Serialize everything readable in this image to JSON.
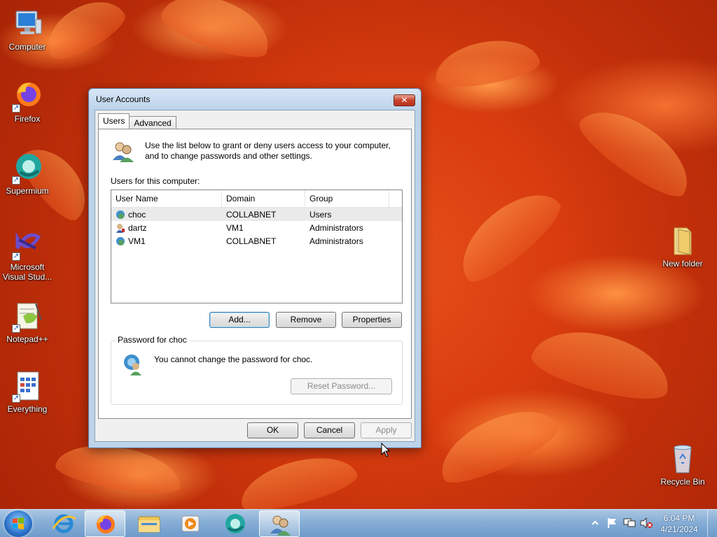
{
  "desktop": {
    "icons": [
      {
        "label": "Computer",
        "name": "computer-icon"
      },
      {
        "label": "Firefox",
        "name": "firefox-icon"
      },
      {
        "label": "Supermium",
        "name": "supermium-icon"
      },
      {
        "label": "Microsoft Visual Stud...",
        "name": "visual-studio-icon"
      },
      {
        "label": "Notepad++",
        "name": "notepadpp-icon"
      },
      {
        "label": "Everything",
        "name": "everything-icon"
      },
      {
        "label": "New folder",
        "name": "folder-icon"
      },
      {
        "label": "Recycle Bin",
        "name": "recycle-bin-icon"
      }
    ]
  },
  "dialog": {
    "title": "User Accounts",
    "close_glyph": "✕",
    "tabs": [
      "Users",
      "Advanced"
    ],
    "intro": "Use the list below to grant or deny users access to your computer, and to change passwords and other settings.",
    "users_label": "Users for this computer:",
    "columns": [
      "User Name",
      "Domain",
      "Group"
    ],
    "rows": [
      {
        "user": "choc",
        "domain": "COLLABNET",
        "group": "Users"
      },
      {
        "user": "dartz",
        "domain": "VM1",
        "group": "Administrators"
      },
      {
        "user": "VM1",
        "domain": "COLLABNET",
        "group": "Administrators"
      }
    ],
    "buttons": {
      "add": "Add...",
      "remove": "Remove",
      "properties": "Properties",
      "reset_password": "Reset Password...",
      "ok": "OK",
      "cancel": "Cancel",
      "apply": "Apply"
    },
    "password_group": "Password for choc",
    "password_text": "You cannot change the password for choc."
  },
  "taskbar": {
    "apps": [
      "internet-explorer",
      "firefox",
      "file-explorer",
      "media-player",
      "supermium",
      "user-accounts"
    ],
    "time": "6:04 PM",
    "date": "4/21/2024"
  },
  "colors": {
    "accent": "#3c7fb1",
    "close": "#c8432c",
    "wallpaper": "#d93c0f"
  }
}
